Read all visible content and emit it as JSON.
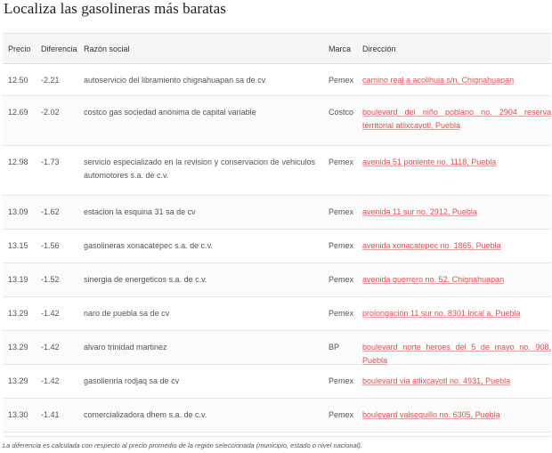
{
  "title": "Localiza las gasolineras más baratas",
  "columns": {
    "precio": "Precio",
    "diferencia": "Diferencia",
    "razon": "Razón social",
    "marca": "Marca",
    "direccion": "Dirección"
  },
  "rows": [
    {
      "precio": "12.50",
      "diferencia": "-2.21",
      "razon": "autoservicio del libramiento chignahuapan sa de cv",
      "marca": "Pemex",
      "direccion": "camino real a acolihuia s/n, Chignahuapan"
    },
    {
      "precio": "12.69",
      "diferencia": "-2.02",
      "razon": "costco gas sociedad anónima de capital variable",
      "marca": "Costco",
      "direccion": "boulevard del niño poblano no. 2904 reserva territorial atlixcayotl, Puebla"
    },
    {
      "precio": "12.98",
      "diferencia": "-1.73",
      "razon": "servicio especializado en la revision y conservacion de vehiculos automotores s.a. de c.v.",
      "marca": "Pemex",
      "direccion": "avenida 51 poniente no. 1118, Puebla"
    },
    {
      "precio": "13.09",
      "diferencia": "-1.62",
      "razon": "estacion la esquina 31 sa de cv",
      "marca": "Pemex",
      "direccion": "avenida 11 sur no. 2912, Puebla"
    },
    {
      "precio": "13.15",
      "diferencia": "-1.56",
      "razon": "gasolineras xonacatepec s.a. de c.v.",
      "marca": "Pemex",
      "direccion": "avenida xonacatepec no. 1865, Puebla"
    },
    {
      "precio": "13.19",
      "diferencia": "-1.52",
      "razon": "sinergia de energeticos s.a. de c.v.",
      "marca": "Pemex",
      "direccion": "avenida guerrero no. 52, Chignahuapan"
    },
    {
      "precio": "13.29",
      "diferencia": "-1.42",
      "razon": "naro de puebla sa de cv",
      "marca": "Pemex",
      "direccion": "prolongación 11 sur no. 8301 local a, Puebla"
    },
    {
      "precio": "13.29",
      "diferencia": "-1.42",
      "razon": "alvaro trinidad martinez",
      "marca": "BP",
      "direccion": "boulevard norte heroes del 5 de mayo no. 908, Puebla"
    },
    {
      "precio": "13.29",
      "diferencia": "-1.42",
      "razon": "gasolienria rodjaq sa de cv",
      "marca": "Pemex",
      "direccion": "boulevard via atlixcayotl no. 4931, Puebla"
    },
    {
      "precio": "13.30",
      "diferencia": "-1.41",
      "razon": "comercializadora dhem s.a. de c.v.",
      "marca": "Pemex",
      "direccion": "boulevard valsequillo no. 6305, Puebla"
    }
  ],
  "footnote": "La diferencia es calculada con respecto al precio promedio de la región seleccionada (municipio, estado o nivel nacional).",
  "colors": {
    "link": "#d9534f",
    "header_bg": "#f6f6f6"
  }
}
